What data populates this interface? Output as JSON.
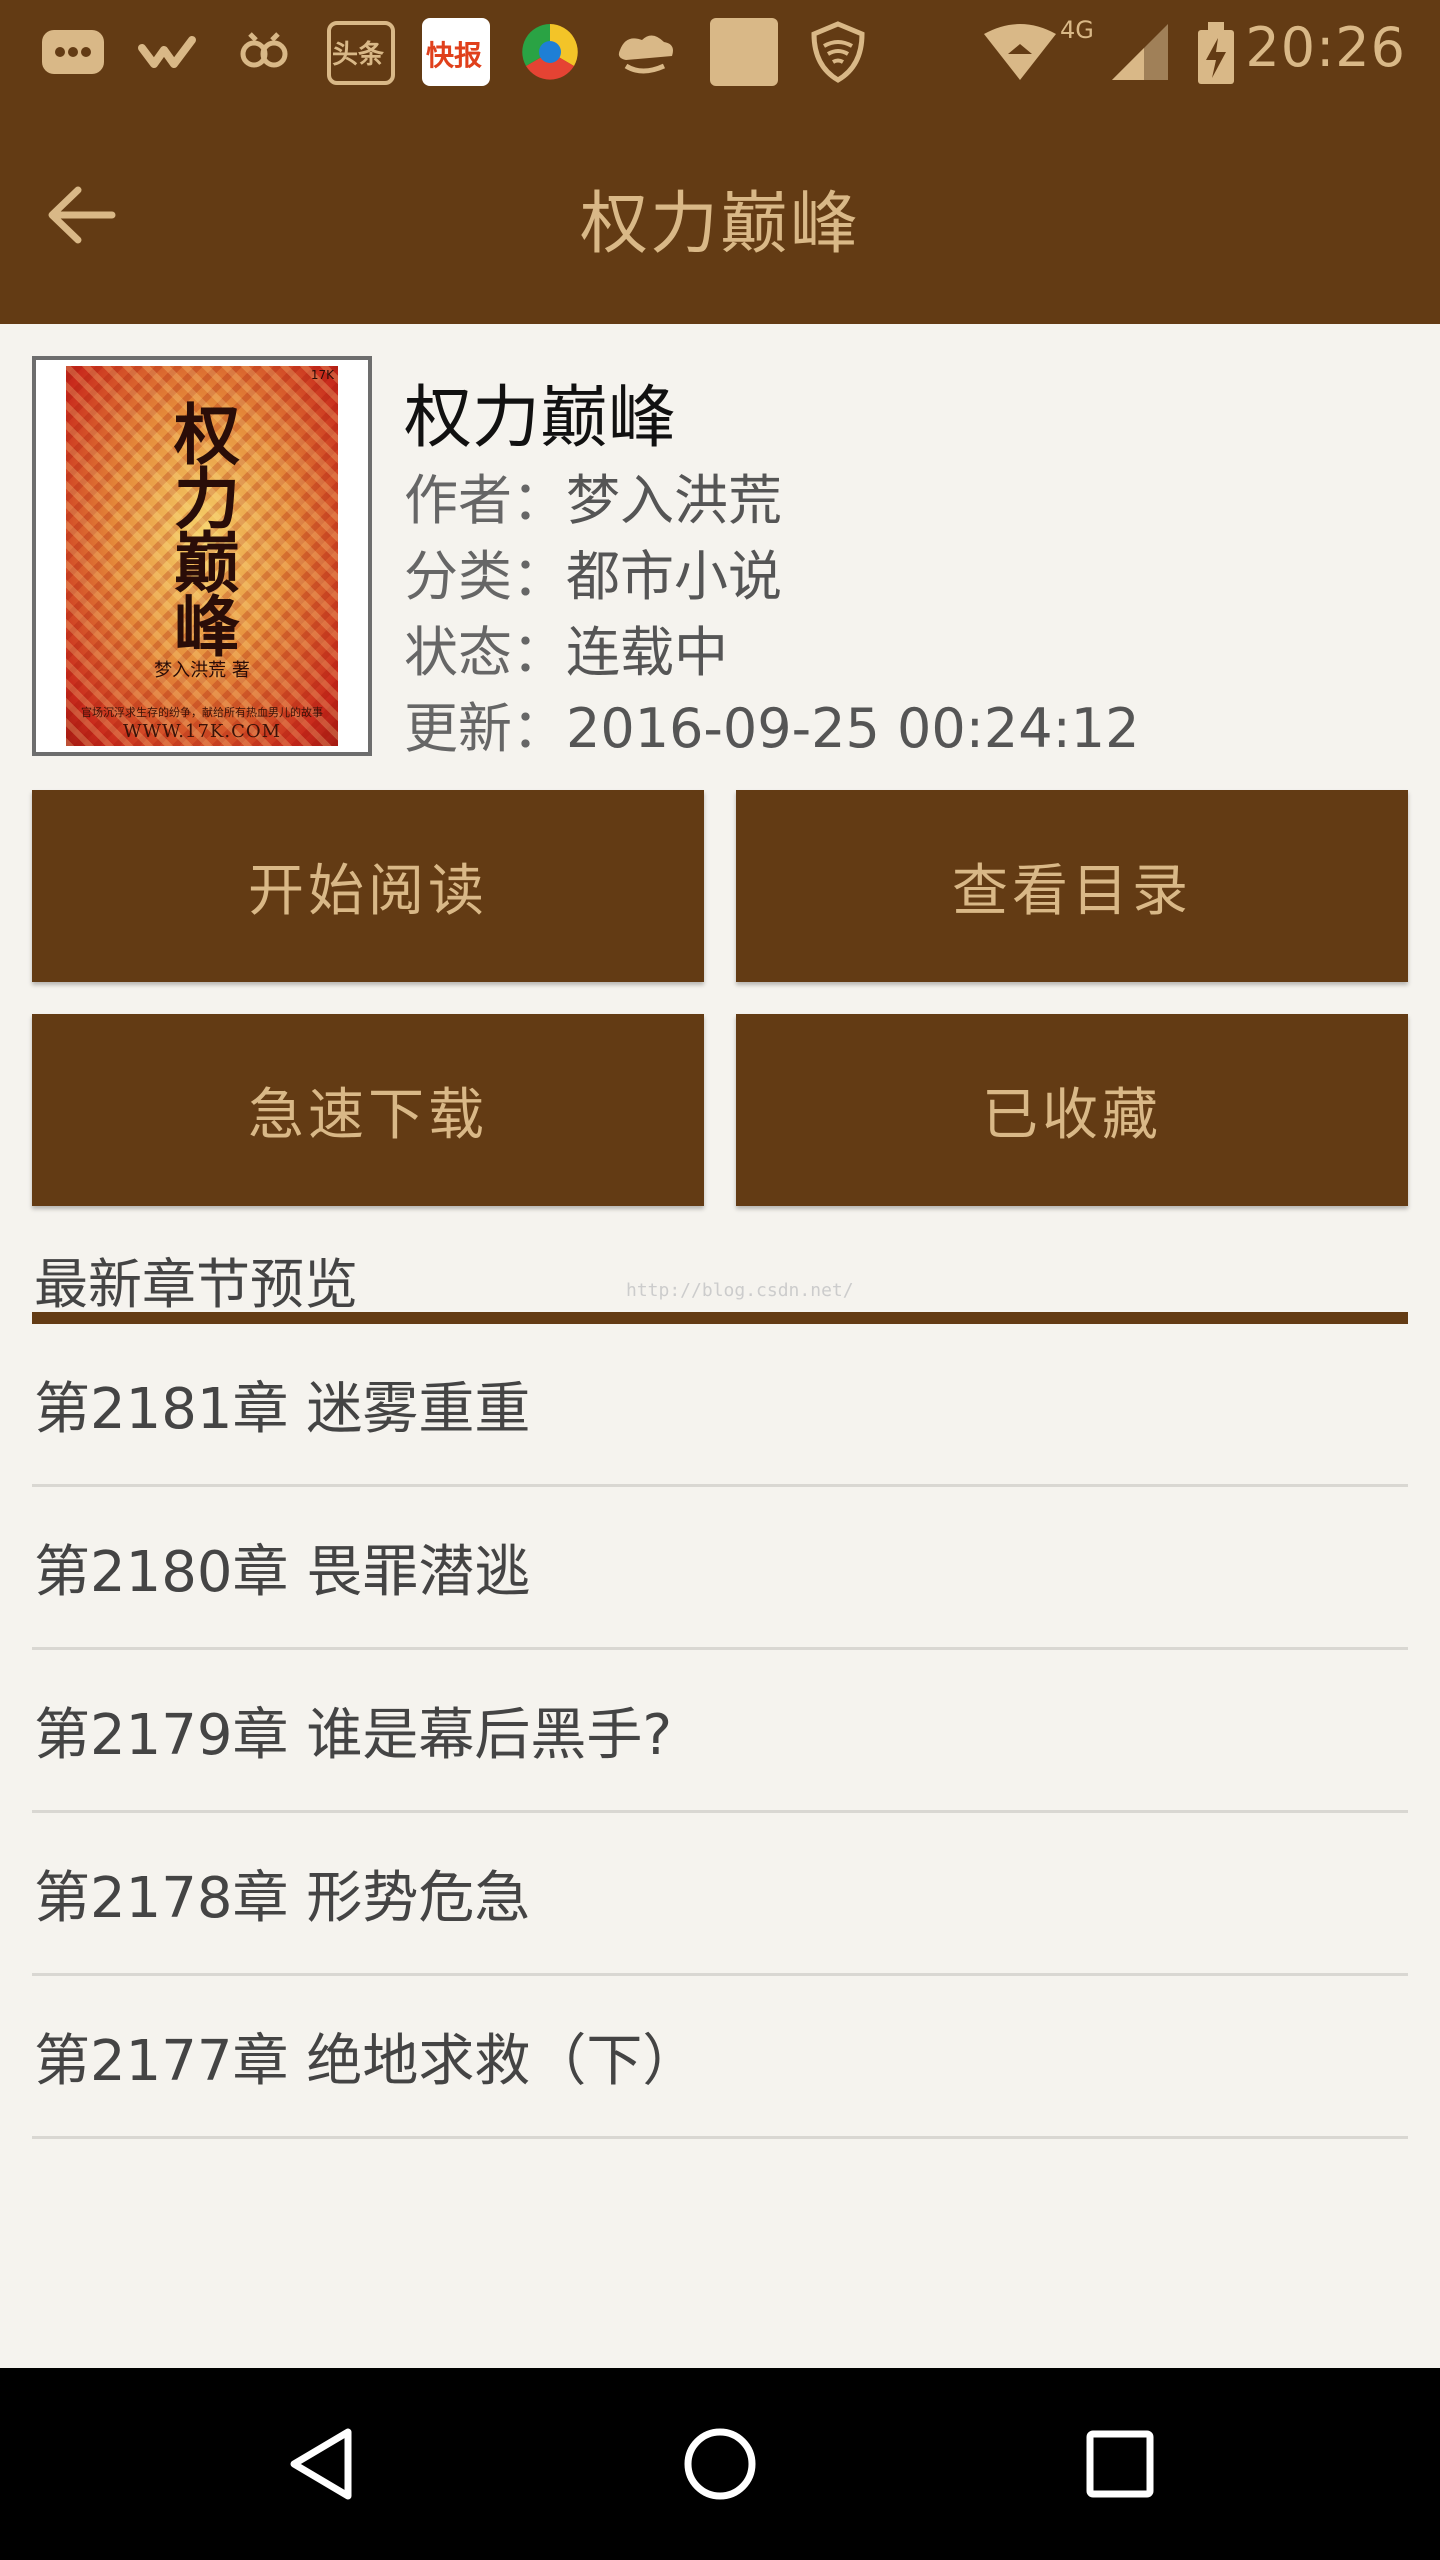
{
  "status_bar": {
    "time": "20:26",
    "network": "4G",
    "notification_icons": [
      "message-icon",
      "weibo-icon",
      "app-icon",
      "toutiao-icon",
      "kuaibao-icon",
      "browser-icon",
      "cloud-icon",
      "square-app-icon",
      "shield-icon"
    ],
    "toutiao_label": "头条",
    "kuaibao_label": "快报"
  },
  "app_bar": {
    "title": "权力巅峰"
  },
  "book": {
    "cover": {
      "title": "权力巅峰",
      "author": "梦入洪荒 著",
      "url": "WWW.17K.COM",
      "tagline": "官场沉浮求生存的纷争，献给所有热血男儿的故事"
    },
    "title": "权力巅峰",
    "author_label": "作者：",
    "author": "梦入洪荒",
    "category_label": "分类：",
    "category": "都市小说",
    "status_label": "状态：",
    "status": "连载中",
    "updated_label": "更新：",
    "updated": "2016-09-25 00:24:12"
  },
  "actions": {
    "start_reading": "开始阅读",
    "view_catalog": "查看目录",
    "fast_download": "急速下载",
    "collected": "已收藏"
  },
  "chapters": {
    "section_title": "最新章节预览",
    "watermark": "http://blog.csdn.net/",
    "items": [
      "第2181章 迷雾重重",
      "第2180章 畏罪潜逃",
      "第2179章 谁是幕后黑手?",
      "第2178章 形势危急",
      "第2177章 绝地求救（下）"
    ]
  },
  "colors": {
    "brand": "#633b14",
    "brand_text": "#d9b887",
    "background": "#f5f3ee"
  }
}
